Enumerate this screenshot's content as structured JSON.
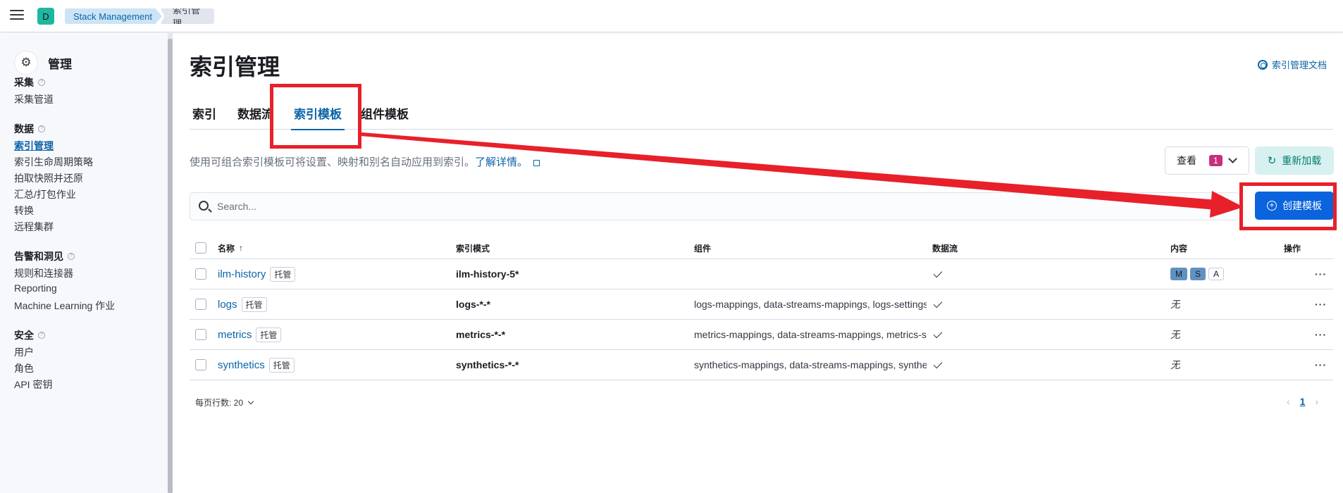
{
  "topbar": {
    "space_initial": "D",
    "breadcrumbs": [
      "Stack Management",
      "索引管理"
    ]
  },
  "sidebar": {
    "title": "管理",
    "groups": [
      {
        "title": "采集",
        "items": [
          "采集管道"
        ]
      },
      {
        "title": "数据",
        "items": [
          "索引管理",
          "索引生命周期策略",
          "拍取快照并还原",
          "汇总/打包作业",
          "转换",
          "远程集群"
        ]
      },
      {
        "title": "告警和洞见",
        "items": [
          "规则和连接器",
          "Reporting",
          "Machine Learning 作业"
        ]
      },
      {
        "title": "安全",
        "items": [
          "用户",
          "角色",
          "API 密钥"
        ]
      }
    ],
    "active_item": "索引管理"
  },
  "main": {
    "title": "索引管理",
    "doc_link": "索引管理文档",
    "tabs": [
      "索引",
      "数据流",
      "索引模板",
      "组件模板"
    ],
    "active_tab": "索引模板",
    "description": "使用可组合索引模板可将设置、映射和别名自动应用到索引。",
    "learn_more": "了解详情。",
    "view_label": "查看",
    "view_count": "1",
    "reload_label": "重新加载",
    "search_placeholder": "Search...",
    "create_label": "创建模板"
  },
  "table": {
    "columns": [
      "名称",
      "索引模式",
      "组件",
      "数据流",
      "内容",
      "操作"
    ],
    "sort_indicator": "↑",
    "rows": [
      {
        "name": "ilm-history",
        "tag": "托管",
        "pattern": "ilm-history-5*",
        "components": "",
        "data_stream": true,
        "content": [
          "M",
          "S",
          "A"
        ]
      },
      {
        "name": "logs",
        "tag": "托管",
        "pattern": "logs-*-*",
        "components": "logs-mappings, data-streams-mappings, logs-settings",
        "data_stream": true,
        "content": "无"
      },
      {
        "name": "metrics",
        "tag": "托管",
        "pattern": "metrics-*-*",
        "components": "metrics-mappings, data-streams-mappings, metrics-settings",
        "data_stream": true,
        "content": "无"
      },
      {
        "name": "synthetics",
        "tag": "托管",
        "pattern": "synthetics-*-*",
        "components": "synthetics-mappings, data-streams-mappings, synthetics-settings",
        "data_stream": true,
        "content": "无"
      }
    ],
    "actions_glyph": "···"
  },
  "footer": {
    "rows_per_page": "每页行数: 20",
    "current_page": "1"
  },
  "colors": {
    "accent": "#0b64a8",
    "primary_button": "#0b64dd",
    "annotation_red": "#e8202a",
    "badge_pink": "#c7307e"
  }
}
